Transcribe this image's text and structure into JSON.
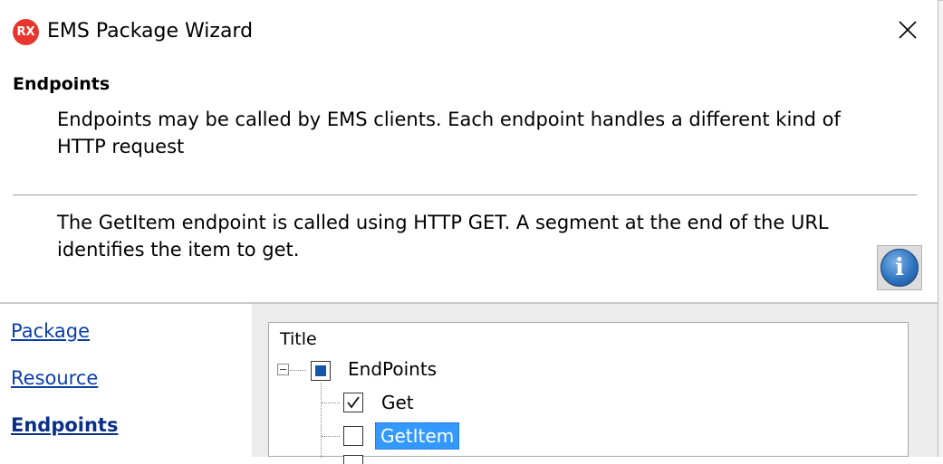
{
  "window": {
    "icon_text": "RX",
    "title": "EMS Package Wizard"
  },
  "header": {
    "title": "Endpoints",
    "description": "Endpoints may be called by EMS clients.  Each endpoint handles a different kind of HTTP request",
    "hint": "The GetItem endpoint is called using HTTP GET.  A segment at the end of the URL identifies the item to get."
  },
  "nav": {
    "items": [
      {
        "label": "Package",
        "active": false
      },
      {
        "label": "Resource",
        "active": false
      },
      {
        "label": "Endpoints",
        "active": true
      }
    ]
  },
  "tree": {
    "column_title": "Title",
    "root": {
      "label": "EndPoints",
      "state": "partial",
      "expanded": true
    },
    "children": [
      {
        "label": "Get",
        "checked": true,
        "selected": false
      },
      {
        "label": "GetItem",
        "checked": false,
        "selected": true
      }
    ]
  },
  "colors": {
    "accent": "#3399ff",
    "link": "#0b3fa8",
    "icon_red": "#e8352e"
  }
}
